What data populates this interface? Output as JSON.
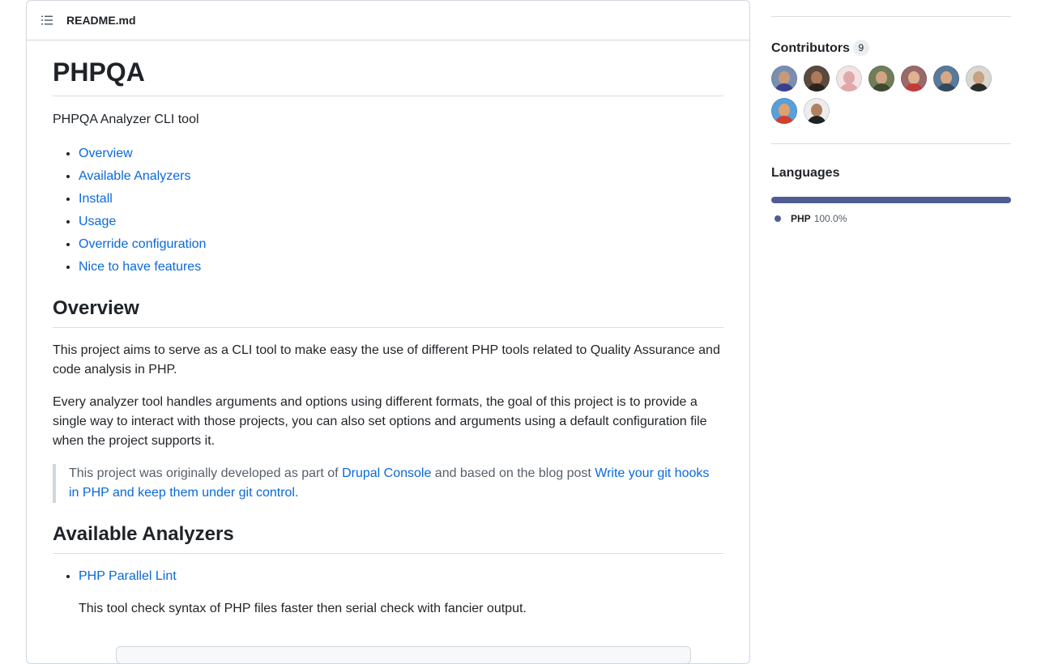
{
  "readme": {
    "filename": "README.md",
    "title": "PHPQA",
    "description": "PHPQA Analyzer CLI tool",
    "toc": [
      "Overview",
      "Available Analyzers",
      "Install",
      "Usage",
      "Override configuration",
      "Nice to have features"
    ],
    "overview": {
      "heading": "Overview",
      "paragraph1": "This project aims to serve as a CLI tool to make easy the use of different PHP tools related to Quality Assurance and code analysis in PHP.",
      "paragraph2": "Every analyzer tool handles arguments and options using different formats, the goal of this project is to provide a single way to interact with those projects, you can also set options and arguments using a default configuration file when the project supports it.",
      "quote": {
        "prefix": "This project was originally developed as part of ",
        "link1": "Drupal Console",
        "middle": " and based on the blog post ",
        "link2": "Write your git hooks in PHP and keep them under git control",
        "suffix": "."
      }
    },
    "analyzers": {
      "heading": "Available Analyzers",
      "items": [
        {
          "name": "PHP Parallel Lint",
          "description": "This tool check syntax of PHP files faster then serial check with fancier output."
        }
      ]
    }
  },
  "sidebar": {
    "contributors": {
      "title": "Contributors",
      "count": "9",
      "avatars": [
        {
          "bg": "#7a8fb0",
          "skin": "#c89a7a",
          "shirt": "#3b3f8f"
        },
        {
          "bg": "#5b4a3e",
          "skin": "#b07a5a",
          "shirt": "#2a2420"
        },
        {
          "bg": "#f2e4e4",
          "skin": "#e0a8a8",
          "shirt": "#e0a8a8"
        },
        {
          "bg": "#6f7d5a",
          "skin": "#d2a484",
          "shirt": "#3d4a32"
        },
        {
          "bg": "#9a6a6a",
          "skin": "#e0b090",
          "shirt": "#c23b3b"
        },
        {
          "bg": "#5a7a9a",
          "skin": "#d8a886",
          "shirt": "#34495e"
        },
        {
          "bg": "#d8d8d0",
          "skin": "#c9a080",
          "shirt": "#2b2b2b"
        },
        {
          "bg": "#5aa0d8",
          "skin": "#e0a070",
          "shirt": "#d04030"
        },
        {
          "bg": "#ededed",
          "skin": "#b08060",
          "shirt": "#222222"
        }
      ]
    },
    "languages": {
      "title": "Languages",
      "items": [
        {
          "name": "PHP",
          "percent": "100.0%",
          "color": "#4F5D95"
        }
      ]
    }
  }
}
